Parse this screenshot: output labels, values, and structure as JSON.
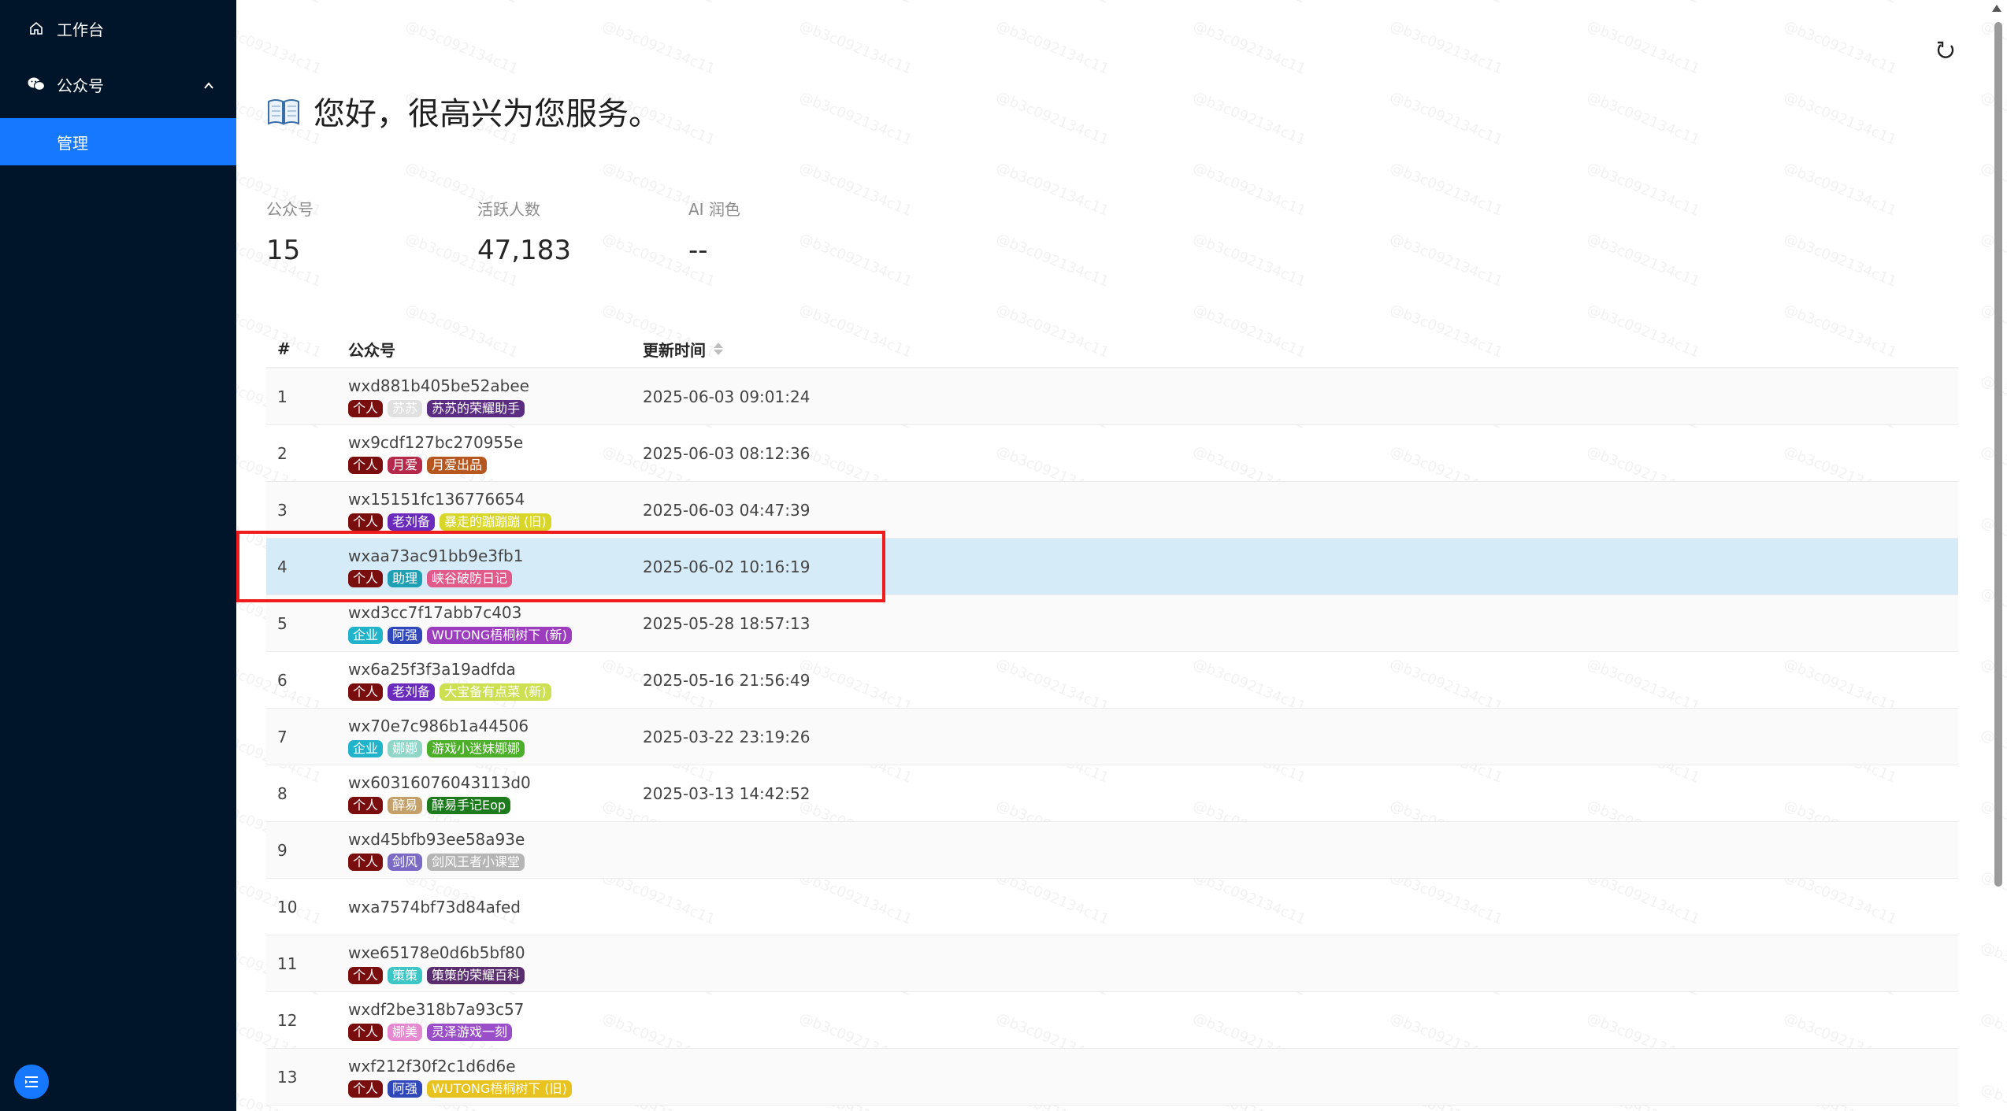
{
  "sidebar": {
    "workbench_label": "工作台",
    "wechat_label": "公众号",
    "manage_label": "管理"
  },
  "header": {
    "greeting": "您好，很高兴为您服务。"
  },
  "stats": [
    {
      "label": "公众号",
      "value": "15"
    },
    {
      "label": "活跃人数",
      "value": "47,183"
    },
    {
      "label": "AI 润色",
      "value": "--"
    }
  ],
  "table": {
    "headers": {
      "index": "#",
      "account": "公众号",
      "updated": "更新时间"
    },
    "rows": [
      {
        "index": "1",
        "account": "wxd881b405be52abee",
        "updated": "2025-06-03 09:01:24",
        "tags": [
          {
            "text": "个人",
            "color": "#7a0d0d"
          },
          {
            "text": "苏苏",
            "color": "#e0e0e0"
          },
          {
            "text": "苏苏的荣耀助手",
            "color": "#5a2d82"
          }
        ]
      },
      {
        "index": "2",
        "account": "wx9cdf127bc270955e",
        "updated": "2025-06-03 08:12:36",
        "tags": [
          {
            "text": "个人",
            "color": "#7a0d0d"
          },
          {
            "text": "月爱",
            "color": "#b5294a"
          },
          {
            "text": "月爱出品",
            "color": "#b5571e"
          }
        ]
      },
      {
        "index": "3",
        "account": "wx15151fc136776654",
        "updated": "2025-06-03 04:47:39",
        "tags": [
          {
            "text": "个人",
            "color": "#7a0d0d"
          },
          {
            "text": "老刘备",
            "color": "#6a2bbd"
          },
          {
            "text": "暴走的蹦蹦蹦 (旧)",
            "color": "#d9d62a"
          }
        ]
      },
      {
        "index": "4",
        "account": "wxaa73ac91bb9e3fb1",
        "updated": "2025-06-02 10:16:19",
        "tags": [
          {
            "text": "个人",
            "color": "#7a0d0d"
          },
          {
            "text": "助理",
            "color": "#1e9fb3"
          },
          {
            "text": "峡谷破防日记",
            "color": "#e05a8a"
          }
        ]
      },
      {
        "index": "5",
        "account": "wxd3cc7f17abb7c403",
        "updated": "2025-05-28 18:57:13",
        "tags": [
          {
            "text": "企业",
            "color": "#21b3c9"
          },
          {
            "text": "阿强",
            "color": "#2f47b8"
          },
          {
            "text": "WUTONG梧桐树下 (新)",
            "color": "#9b3dbd"
          }
        ]
      },
      {
        "index": "6",
        "account": "wx6a25f3f3a19adfda",
        "updated": "2025-05-16 21:56:49",
        "tags": [
          {
            "text": "个人",
            "color": "#7a0d0d"
          },
          {
            "text": "老刘备",
            "color": "#6a2bbd"
          },
          {
            "text": "大宝备有点菜 (新)",
            "color": "#cde052"
          }
        ]
      },
      {
        "index": "7",
        "account": "wx70e7c986b1a44506",
        "updated": "2025-03-22 23:19:26",
        "tags": [
          {
            "text": "企业",
            "color": "#21b3c9"
          },
          {
            "text": "娜娜",
            "color": "#8fd6c7"
          },
          {
            "text": "游戏小迷妹娜娜",
            "color": "#4caf2a"
          }
        ]
      },
      {
        "index": "8",
        "account": "wx60316076043113d0",
        "updated": "2025-03-13 14:42:52",
        "tags": [
          {
            "text": "个人",
            "color": "#7a0d0d"
          },
          {
            "text": "醉易",
            "color": "#c4a06a"
          },
          {
            "text": "醉易手记Eop",
            "color": "#1d7a1d"
          }
        ]
      },
      {
        "index": "9",
        "account": "wxd45bfb93ee58a93e",
        "updated": "",
        "tags": [
          {
            "text": "个人",
            "color": "#7a0d0d"
          },
          {
            "text": "剑风",
            "color": "#7b6bc4"
          },
          {
            "text": "剑风王者小课堂",
            "color": "#b5b5b5"
          }
        ]
      },
      {
        "index": "10",
        "account": "wxa7574bf73d84afed",
        "updated": "",
        "tags": []
      },
      {
        "index": "11",
        "account": "wxe65178e0d6b5bf80",
        "updated": "",
        "tags": [
          {
            "text": "个人",
            "color": "#7a0d0d"
          },
          {
            "text": "策策",
            "color": "#3cc6c6"
          },
          {
            "text": "策策的荣耀百科",
            "color": "#5a2d6e"
          }
        ]
      },
      {
        "index": "12",
        "account": "wxdf2be318b7a93c57",
        "updated": "",
        "tags": [
          {
            "text": "个人",
            "color": "#7a0d0d"
          },
          {
            "text": "娜美",
            "color": "#e58ad0"
          },
          {
            "text": "灵泽游戏一刻",
            "color": "#9a4fc9"
          }
        ]
      },
      {
        "index": "13",
        "account": "wxf212f30f2c1d6d6e",
        "updated": "",
        "tags": [
          {
            "text": "个人",
            "color": "#7a0d0d"
          },
          {
            "text": "阿强",
            "color": "#2f47b8"
          },
          {
            "text": "WUTONG梧桐树下 (旧)",
            "color": "#e8c21f"
          }
        ]
      }
    ],
    "selected_index": "4"
  },
  "watermark_text": "@b3c092134c11"
}
